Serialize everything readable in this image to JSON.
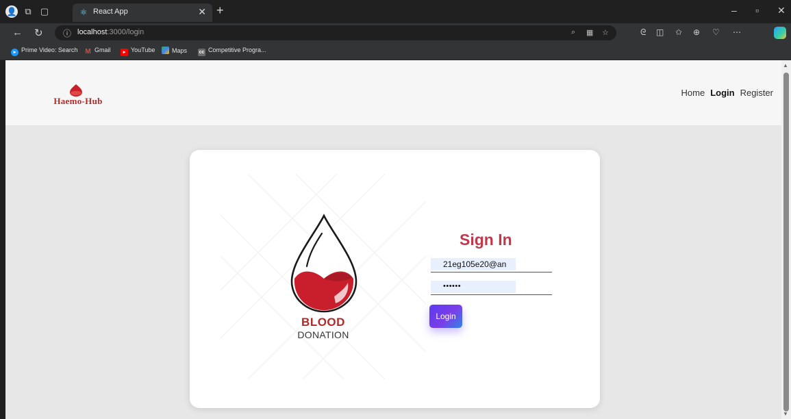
{
  "browser": {
    "tab_title": "React App",
    "url_host": "localhost",
    "url_path": ":3000/login",
    "bookmarks": [
      {
        "label": "Prime Video: Search",
        "color": "#1a98ff"
      },
      {
        "label": "Gmail",
        "color": "#ea4335"
      },
      {
        "label": "YouTube",
        "color": "#ff0000"
      },
      {
        "label": "Maps",
        "color": "#34a853"
      },
      {
        "label": "Competitive Progra...",
        "color": "#6b6b6b"
      }
    ]
  },
  "site": {
    "logo_text": "Haemo-Hub",
    "menu": [
      "Home",
      "Login",
      "Register"
    ],
    "brand_color": "#b52b2b"
  },
  "card": {
    "blood": "BLOOD",
    "donation": "DONATION",
    "signin_title": "Sign In",
    "email_value": "21eg105e20@an",
    "password_mask": "••••••",
    "login_label": "Login"
  }
}
